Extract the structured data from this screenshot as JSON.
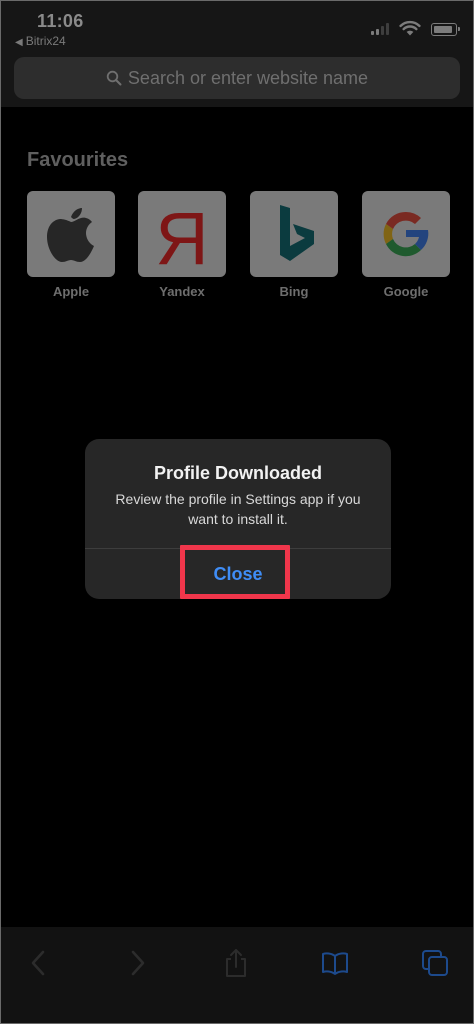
{
  "status_bar": {
    "time": "11:06",
    "back_app": "Bitrix24",
    "back_icon": "back-triangle-icon"
  },
  "address_bar": {
    "placeholder": "Search or enter website name",
    "icon": "search-icon"
  },
  "favourites": {
    "title": "Favourites",
    "items": [
      {
        "label": "Apple",
        "icon": "apple-logo-icon"
      },
      {
        "label": "Yandex",
        "icon": "yandex-logo-icon",
        "text": "Я"
      },
      {
        "label": "Bing",
        "icon": "bing-logo-icon"
      },
      {
        "label": "Google",
        "icon": "google-logo-icon"
      }
    ]
  },
  "alert": {
    "title": "Profile Downloaded",
    "message": "Review the profile in Settings app if you want to install it.",
    "button": "Close"
  },
  "toolbar": {
    "items": [
      "back-chevron-icon",
      "forward-chevron-icon",
      "share-icon",
      "bookmarks-book-icon",
      "tabs-icon"
    ]
  },
  "colors": {
    "accent": "#3f8df6",
    "highlight": "#f0364b",
    "background": "#000000"
  }
}
